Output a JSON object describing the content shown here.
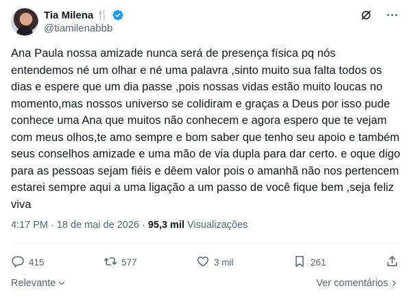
{
  "author": {
    "display_name": "Tia Milena",
    "handle": "@tiamilenabbb",
    "emoji": "🍴"
  },
  "tweet": {
    "text": "Ana Paula nossa amizade nunca será de presença física pq nós entendemos né um olhar e né uma palavra ,sinto muito sua falta todos os dias e espere que um dia passe ,pois nossas vidas estão muito loucas no momento,mas nossos universo se colidiram e graças a Deus por isso pude conhece uma Ana que muitos não conhecem e agora espero que te vejam com meus olhos,te amo sempre e bom saber que tenho seu apoio e também seus conselhos amizade e uma mão de via dupla para dar certo. e oque digo para as pessoas sejam fiéis e dêem valor pois o amanhã não nos pertencem estarei sempre aqui a uma ligação a um passo de você fique bem ,seja feliz viva",
    "time": "4:17 PM",
    "date": "18 de mai de 2026",
    "views_count": "95,3 mil",
    "views_label": "Visualizações"
  },
  "actions": {
    "replies": "415",
    "reposts": "577",
    "likes": "3 mil",
    "bookmarks": "261"
  },
  "footer": {
    "sort_label": "Relevante",
    "comments_link": "Ver comentários"
  },
  "colors": {
    "verified": "#1d9bf0",
    "secondary_text": "#536471",
    "primary_text": "#0f1419"
  }
}
